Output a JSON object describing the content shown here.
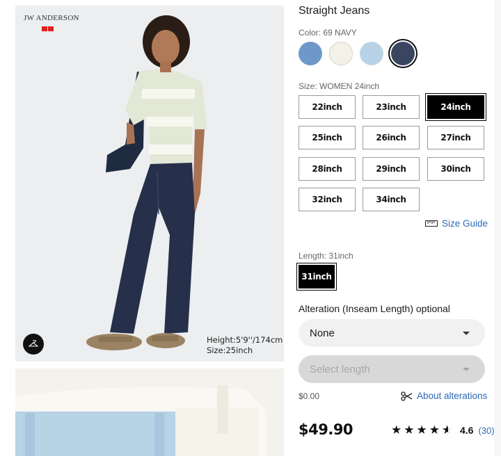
{
  "gallery": {
    "brand_text": "JW ANDERSON",
    "model_height": "Height:5'9''/174cm",
    "model_size": "Size:25inch"
  },
  "product": {
    "title": "Straight Jeans",
    "color_label": "Color: 69 NAVY",
    "colors": [
      {
        "name": "light-blue",
        "hex": "#6e98c8"
      },
      {
        "name": "off-white",
        "hex": "#f3f1e8"
      },
      {
        "name": "pale-blue",
        "hex": "#b8d3e8"
      },
      {
        "name": "navy",
        "hex": "#3a4560",
        "selected": true
      }
    ],
    "size_label": "Size: WOMEN 24inch",
    "sizes": [
      "22inch",
      "23inch",
      "24inch",
      "25inch",
      "26inch",
      "27inch",
      "28inch",
      "29inch",
      "30inch",
      "32inch",
      "34inch"
    ],
    "selected_size": "24inch",
    "size_guide": "Size Guide",
    "length_label": "Length: 31inch",
    "length_value": "31inch",
    "alteration_title": "Alteration (Inseam Length) optional",
    "alteration_select": "None",
    "length_select_placeholder": "Select length",
    "alteration_fee": "$0.00",
    "about_alterations": "About alterations",
    "price": "$49.90",
    "rating_value": "4.6",
    "rating_count": "(30)",
    "stars": 4.5
  }
}
